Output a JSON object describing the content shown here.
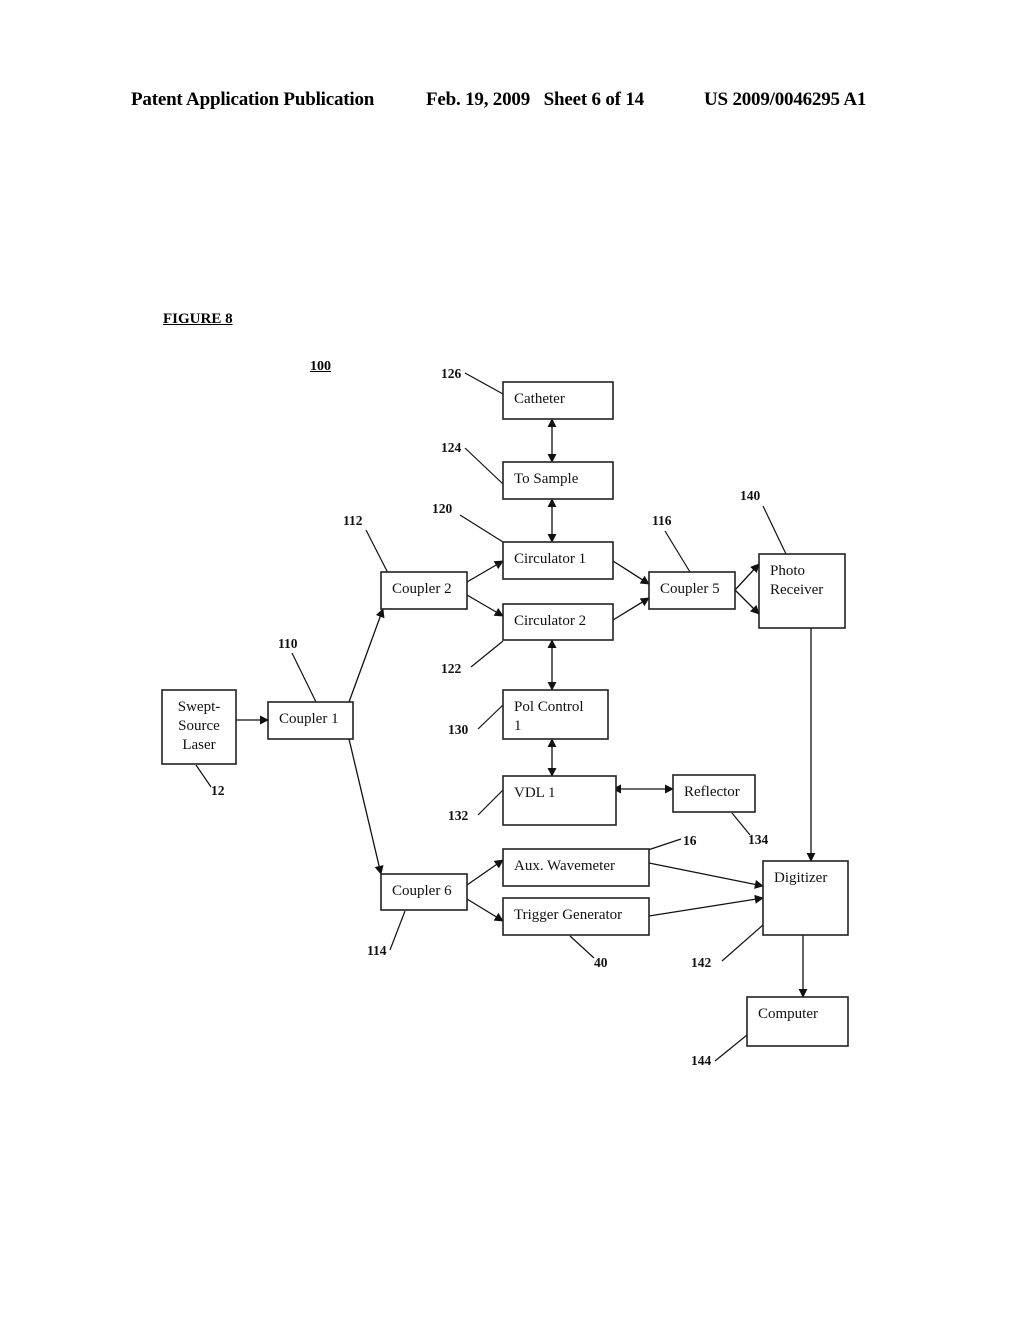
{
  "header": {
    "left": "Patent Application Publication",
    "middle": "Feb. 19, 2009   Sheet 6 of 14",
    "right": "US 2009/0046295 A1"
  },
  "figure": {
    "title": "FIGURE 8",
    "reference": "100"
  },
  "blocks": [
    {
      "id": "laser",
      "lines": [
        "Swept-",
        "Source",
        "Laser"
      ],
      "ref": "12"
    },
    {
      "id": "coupler1",
      "lines": [
        "Coupler 1"
      ],
      "ref": "110"
    },
    {
      "id": "coupler2",
      "lines": [
        "Coupler 2"
      ],
      "ref": "112"
    },
    {
      "id": "coupler6",
      "lines": [
        "Coupler 6"
      ],
      "ref": "114"
    },
    {
      "id": "catheter",
      "lines": [
        "Catheter"
      ],
      "ref": "126"
    },
    {
      "id": "tosample",
      "lines": [
        "To Sample"
      ],
      "ref": "124"
    },
    {
      "id": "circ1",
      "lines": [
        "Circulator 1"
      ],
      "ref": "120"
    },
    {
      "id": "circ2",
      "lines": [
        "Circulator 2"
      ],
      "ref": "122"
    },
    {
      "id": "coupler5",
      "lines": [
        "Coupler 5"
      ],
      "ref": "116"
    },
    {
      "id": "photo",
      "lines": [
        "Photo",
        "Receiver"
      ],
      "ref": "140"
    },
    {
      "id": "pol",
      "lines": [
        "Pol Control",
        "1"
      ],
      "ref": "130"
    },
    {
      "id": "vdl",
      "lines": [
        "VDL 1"
      ],
      "ref": "132"
    },
    {
      "id": "reflector",
      "lines": [
        "Reflector"
      ],
      "ref": "134"
    },
    {
      "id": "wavemeter",
      "lines": [
        "Aux. Wavemeter"
      ],
      "ref": "16"
    },
    {
      "id": "trigger",
      "lines": [
        "Trigger Generator"
      ],
      "ref": "40"
    },
    {
      "id": "digitizer",
      "lines": [
        "Digitizer"
      ],
      "ref": "142"
    },
    {
      "id": "computer",
      "lines": [
        "Computer"
      ],
      "ref": "144"
    }
  ],
  "connections": [
    {
      "from": "laser",
      "to": "coupler1",
      "type": "one-way"
    },
    {
      "from": "coupler1",
      "to": "coupler2",
      "type": "one-way"
    },
    {
      "from": "coupler1",
      "to": "coupler6",
      "type": "one-way"
    },
    {
      "from": "coupler2",
      "to": "circ1",
      "type": "one-way"
    },
    {
      "from": "coupler2",
      "to": "circ2",
      "type": "one-way"
    },
    {
      "from": "catheter",
      "to": "tosample",
      "type": "two-way"
    },
    {
      "from": "tosample",
      "to": "circ1",
      "type": "two-way"
    },
    {
      "from": "circ1",
      "to": "coupler5",
      "type": "one-way"
    },
    {
      "from": "circ2",
      "to": "coupler5",
      "type": "one-way"
    },
    {
      "from": "coupler5",
      "to": "photo",
      "type": "one-way",
      "port": "upper"
    },
    {
      "from": "coupler5",
      "to": "photo",
      "type": "one-way",
      "port": "lower"
    },
    {
      "from": "circ2",
      "to": "pol",
      "type": "two-way"
    },
    {
      "from": "pol",
      "to": "vdl",
      "type": "two-way"
    },
    {
      "from": "vdl",
      "to": "reflector",
      "type": "two-way"
    },
    {
      "from": "photo",
      "to": "digitizer",
      "type": "one-way"
    },
    {
      "from": "coupler6",
      "to": "wavemeter",
      "type": "one-way"
    },
    {
      "from": "coupler6",
      "to": "trigger",
      "type": "one-way"
    },
    {
      "from": "wavemeter",
      "to": "digitizer",
      "type": "one-way"
    },
    {
      "from": "trigger",
      "to": "digitizer",
      "type": "one-way"
    },
    {
      "from": "digitizer",
      "to": "computer",
      "type": "one-way"
    }
  ]
}
